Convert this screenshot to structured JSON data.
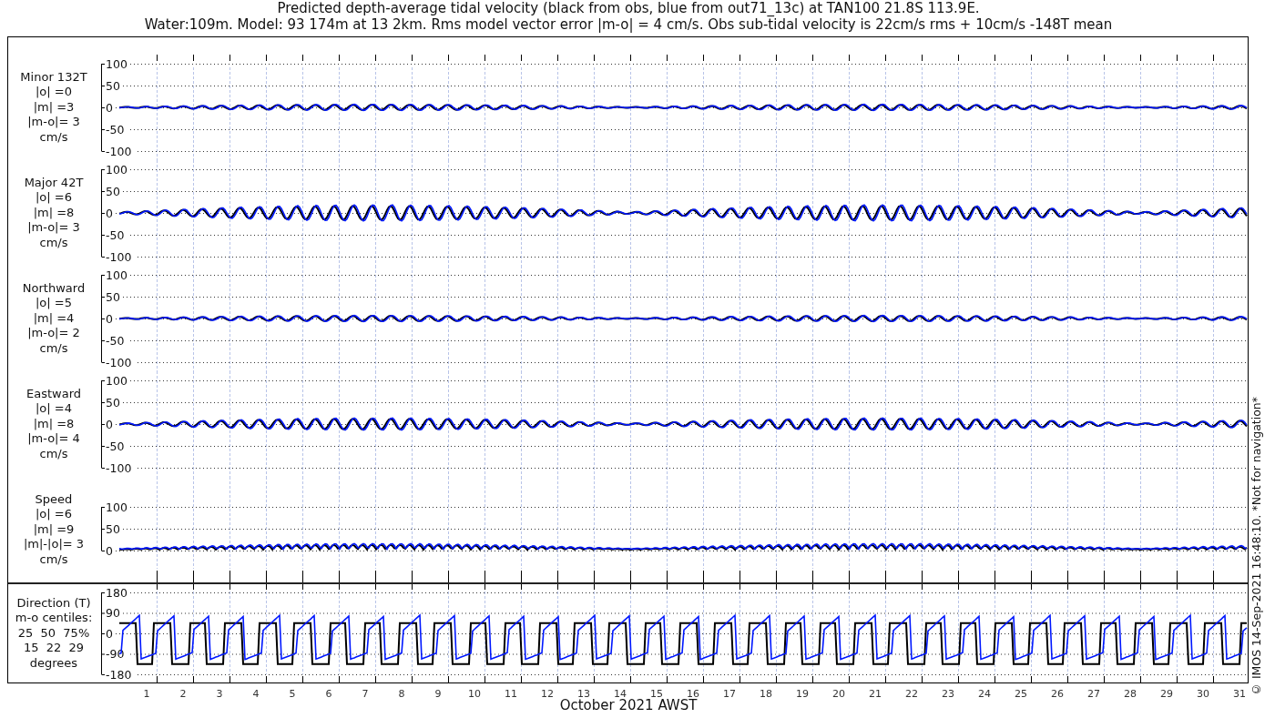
{
  "title": {
    "line1": "Predicted depth-average tidal velocity (black from obs, blue from out71_13c) at TAN100 21.8S 113.9E.",
    "line2": "Water:109m. Model: 93 174m at 13 2km. Rms model vector error |m-o| = 4 cm/s. Obs sub-tidal velocity is 22cm/s rms + 10cm/s -148T mean"
  },
  "panels": [
    {
      "kind": "velocity",
      "label_lines": [
        "Minor 132T",
        "|o| =0",
        "|m| =3",
        "|m-o|= 3",
        "cm/s"
      ],
      "yticks": [
        "100",
        "50",
        "0",
        "-50",
        "-100"
      ]
    },
    {
      "kind": "velocity",
      "label_lines": [
        "Major 42T",
        "|o| =6",
        "|m| =8",
        "|m-o|= 3",
        "cm/s"
      ],
      "yticks": [
        "100",
        "50",
        "0",
        "-50",
        "-100"
      ]
    },
    {
      "kind": "velocity",
      "label_lines": [
        "Northward",
        "|o| =5",
        "|m| =4",
        "|m-o|= 2",
        "cm/s"
      ],
      "yticks": [
        "100",
        "50",
        "0",
        "-50",
        "-100"
      ]
    },
    {
      "kind": "velocity",
      "label_lines": [
        "Eastward",
        "|o| =4",
        "|m| =8",
        "|m-o|= 4",
        "cm/s"
      ],
      "yticks": [
        "100",
        "50",
        "0",
        "-50",
        "-100"
      ]
    },
    {
      "kind": "speed",
      "label_lines": [
        "Speed",
        "|o| =6",
        "|m| =9",
        "|m|-|o|= 3",
        "cm/s"
      ],
      "yticks": [
        "100",
        "50",
        "0"
      ]
    },
    {
      "kind": "direction",
      "label_lines": [
        "Direction (T)",
        "m-o centiles:",
        "25  50  75%",
        "15  22  29",
        "degrees"
      ],
      "yticks": [
        "180",
        "90",
        "0",
        "-90",
        "-180"
      ]
    }
  ],
  "x_axis": {
    "ticks": [
      "1",
      "2",
      "3",
      "4",
      "5",
      "6",
      "7",
      "8",
      "9",
      "10",
      "11",
      "12",
      "13",
      "14",
      "15",
      "16",
      "17",
      "18",
      "19",
      "20",
      "21",
      "22",
      "23",
      "24",
      "25",
      "26",
      "27",
      "28",
      "29",
      "30",
      "31"
    ],
    "label": "October 2021 AWST"
  },
  "copyright": "© IMOS 14-Sep-2021 16:48:10. *Not for navigation*"
}
